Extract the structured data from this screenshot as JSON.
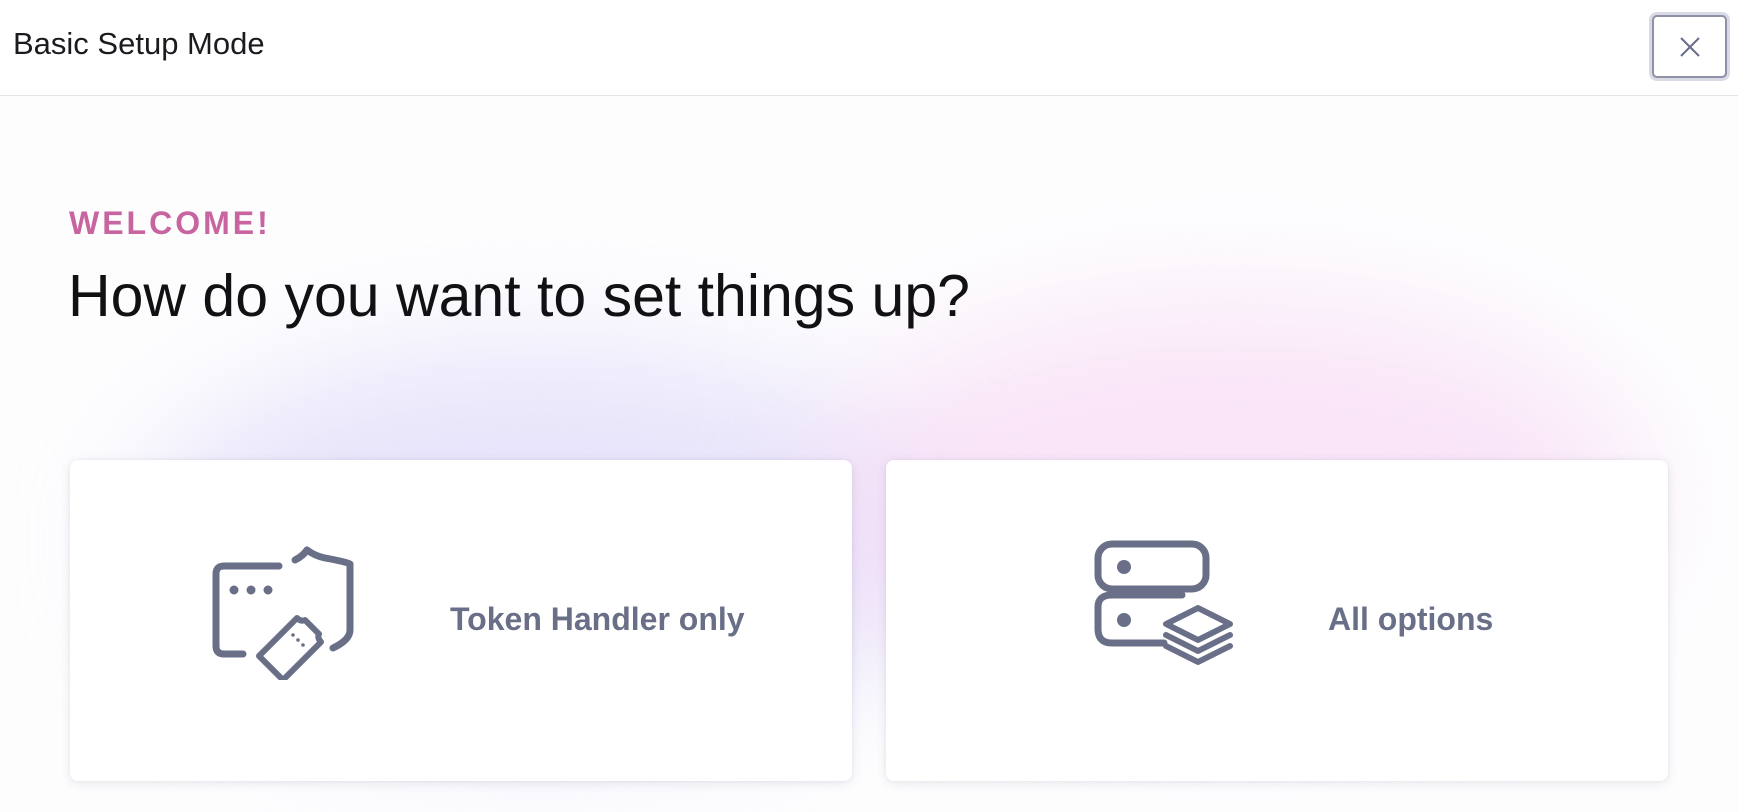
{
  "window": {
    "title": "Basic Setup Mode",
    "close_icon": "close-icon"
  },
  "main": {
    "eyebrow": "WELCOME!",
    "heading": "How do you want to set things up?",
    "options": [
      {
        "label": "Token Handler only",
        "icon": "token-shield-icon"
      },
      {
        "label": "All options",
        "icon": "server-stack-icon"
      }
    ]
  },
  "colors": {
    "accent": "#c8649f",
    "icon": "#6a6f88",
    "heading": "#111114"
  }
}
